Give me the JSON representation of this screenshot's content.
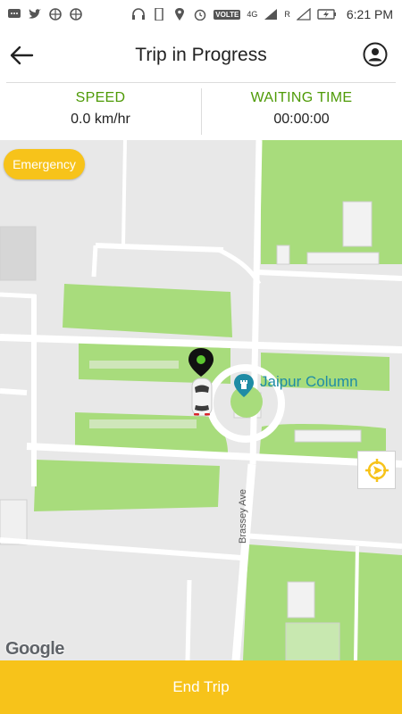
{
  "status_bar": {
    "time": "6:21 PM",
    "volte": "VOLTE",
    "network": "4G",
    "roaming": "R",
    "icons": [
      "messages-icon",
      "twitter-icon",
      "sync-icon",
      "sync-icon",
      "headset-icon",
      "phone-icon",
      "location-icon",
      "alarm-icon",
      "signal-icon",
      "signal-icon",
      "battery-charging-icon"
    ]
  },
  "header": {
    "title": "Trip in Progress"
  },
  "stats": {
    "speed_label": "SPEED",
    "speed_value": "0.0 km/hr",
    "waiting_label": "WAITING TIME",
    "waiting_value": "00:00:00"
  },
  "map": {
    "emergency_label": "Emergency",
    "poi_label": "Jaipur Column",
    "street_label": "Brassey Ave",
    "attribution": "Google"
  },
  "footer": {
    "end_trip_label": "End Trip"
  },
  "colors": {
    "accent": "#f7c31a",
    "label_green": "#4e9a06",
    "park_green": "#a8dc7c",
    "poi_blue": "#1f8ca5"
  }
}
